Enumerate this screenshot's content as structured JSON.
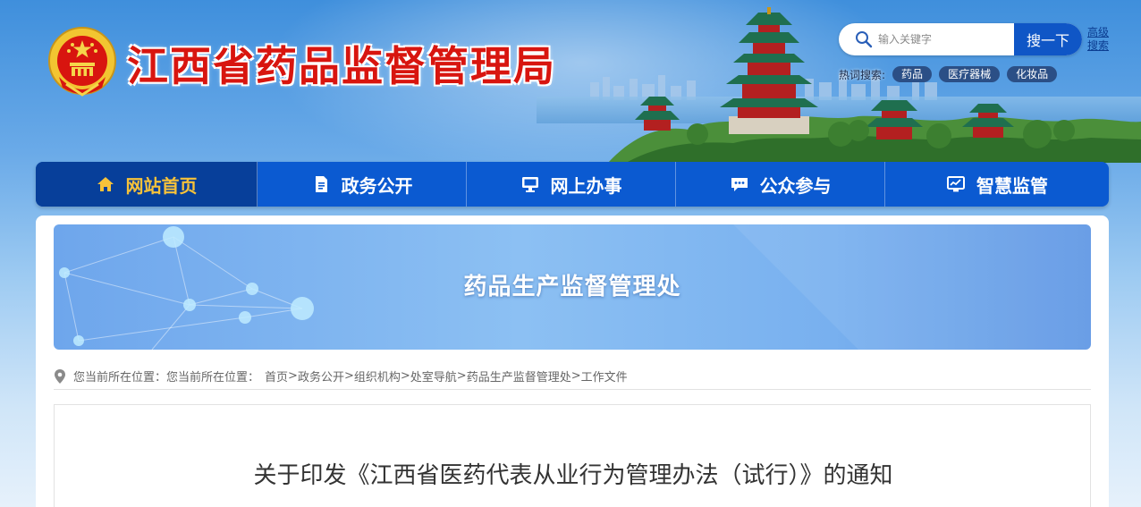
{
  "header": {
    "site_title": "江西省药品监督管理局",
    "emblem_icon": "national-emblem-icon",
    "search": {
      "placeholder": "输入关键字",
      "button_label": "搜一下",
      "advanced_label": "高级搜索"
    },
    "hot_search": {
      "label": "热词搜索:",
      "tags": [
        "药品",
        "医疗器械",
        "化妆品"
      ]
    }
  },
  "nav": {
    "items": [
      {
        "label": "网站首页",
        "icon": "home-icon",
        "active": true
      },
      {
        "label": "政务公开",
        "icon": "document-icon",
        "active": false
      },
      {
        "label": "网上办事",
        "icon": "monitor-icon",
        "active": false
      },
      {
        "label": "公众参与",
        "icon": "chat-icon",
        "active": false
      },
      {
        "label": "智慧监管",
        "icon": "dashboard-icon",
        "active": false
      }
    ]
  },
  "banner": {
    "title": "药品生产监督管理处"
  },
  "breadcrumb": {
    "prefix": "您当前所在位置：您当前所在位置：",
    "items": [
      "首页",
      "政务公开",
      "组织机构",
      "处室导航",
      "药品生产监督管理处",
      "工作文件"
    ],
    "separator": ">"
  },
  "article": {
    "title": "关于印发《江西省医药代表从业行为管理办法（试行）》的通知"
  },
  "colors": {
    "title_red": "#d8150f",
    "nav_blue": "#0b5ad1",
    "nav_active_bg": "#073f9a",
    "nav_active_text": "#f7c23a",
    "search_button": "#0f56c6"
  }
}
